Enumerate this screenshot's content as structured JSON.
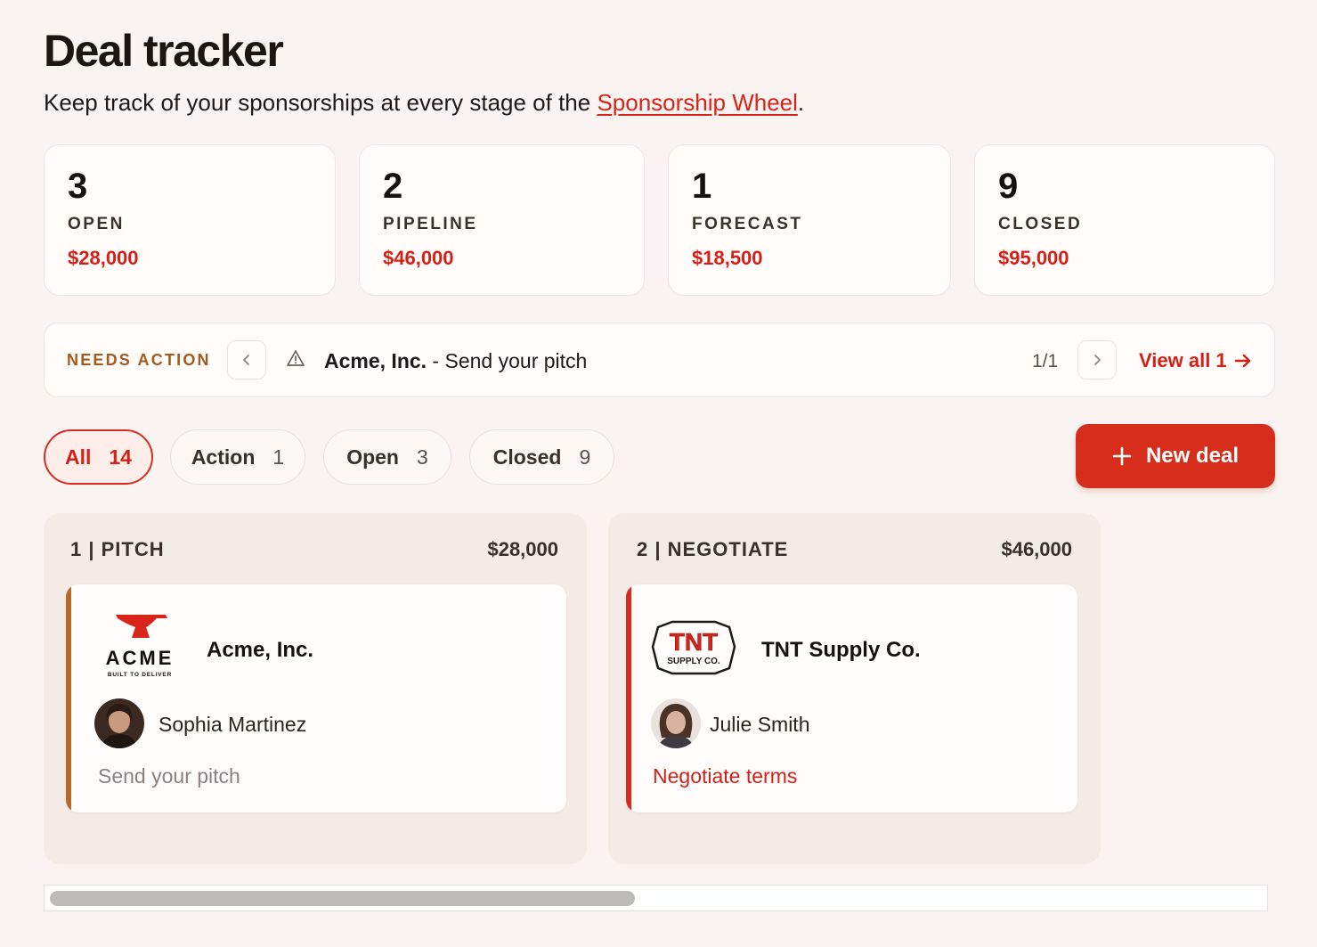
{
  "header": {
    "title": "Deal tracker",
    "subtitle_prefix": "Keep track of your sponsorships at every stage of the ",
    "subtitle_link": "Sponsorship Wheel",
    "subtitle_suffix": "."
  },
  "stats": [
    {
      "count": "3",
      "label": "OPEN",
      "amount": "$28,000"
    },
    {
      "count": "2",
      "label": "PIPELINE",
      "amount": "$46,000"
    },
    {
      "count": "1",
      "label": "FORECAST",
      "amount": "$18,500"
    },
    {
      "count": "9",
      "label": "CLOSED",
      "amount": "$95,000"
    }
  ],
  "needs_action": {
    "tag": "NEEDS ACTION",
    "company": "Acme, Inc.",
    "separator": " - ",
    "task": "Send your pitch",
    "pager": "1/1",
    "view_all": "View all 1",
    "icons": {
      "prev": "chevron-left-icon",
      "next": "chevron-right-icon",
      "warning": "warning-triangle-icon",
      "arrow": "arrow-right-icon"
    }
  },
  "filters": [
    {
      "label": "All",
      "count": "14",
      "active": true
    },
    {
      "label": "Action",
      "count": "1",
      "active": false
    },
    {
      "label": "Open",
      "count": "3",
      "active": false
    },
    {
      "label": "Closed",
      "count": "9",
      "active": false
    }
  ],
  "new_deal": {
    "label": "New deal",
    "icon": "plus-icon"
  },
  "columns": [
    {
      "title": "1 | PITCH",
      "amount": "$28,000",
      "cards": [
        {
          "company": "Acme, Inc.",
          "logo_text": "ACME",
          "logo_tagline": "BUILT TO DELIVER",
          "contact": "Sophia Martinez",
          "next_step": "Send your pitch",
          "accent": "#b8692a",
          "next_color": "#8a817c"
        }
      ]
    },
    {
      "title": "2 | NEGOTIATE",
      "amount": "$46,000",
      "cards": [
        {
          "company": "TNT Supply Co.",
          "logo_text": "TNT",
          "logo_tagline": "SUPPLY CO.",
          "contact": "Julie Smith",
          "next_step": "Negotiate terms",
          "accent": "#d92b22",
          "next_color": "#d61f16"
        }
      ]
    }
  ],
  "colors": {
    "brand": "#d72d1b",
    "background": "#f9f4f1",
    "accent_text": "#d61f16"
  }
}
